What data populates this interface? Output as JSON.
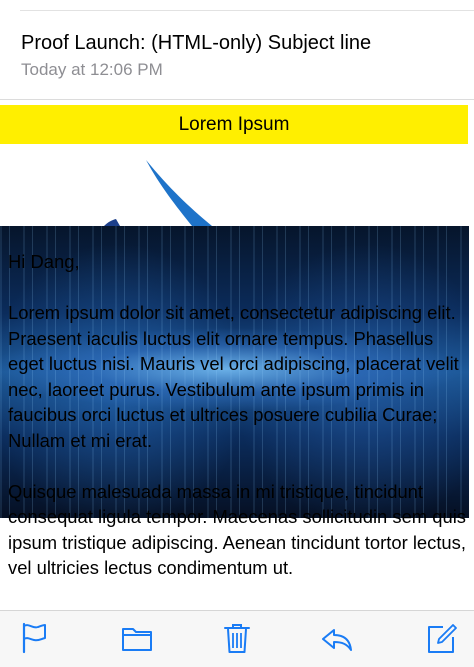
{
  "message": {
    "subject": "Proof Launch: (HTML-only) Subject line",
    "date": "Today at 12:06 PM"
  },
  "email": {
    "banner_text": "Lorem Ipsum",
    "greeting": "Hi Dang,",
    "paragraph1": "Lorem ipsum dolor sit amet, consectetur adipiscing elit. Praesent iaculis luctus elit ornare tempus. Phasellus eget luctus nisi. Mauris vel orci adipiscing, placerat velit nec, laoreet purus. Vestibulum ante ipsum primis in faucibus orci luctus et ultrices posuere cubilia Curae; Nullam et mi erat.",
    "paragraph2": "Quisque malesuada massa in mi tristique, tincidunt consequat ligula tempor. Maecenas sollicitudin sem quis ipsum tristique adipiscing. Aenean tincidunt tortor lectus, vel ultricies lectus condimentum ut."
  },
  "toolbar": {
    "icons": [
      "flag-icon",
      "folder-icon",
      "trash-icon",
      "reply-icon",
      "compose-icon"
    ]
  },
  "colors": {
    "banner": "#ffef00",
    "toolbar_tint": "#1a7cf5",
    "secondary_text": "#8e8e93"
  }
}
